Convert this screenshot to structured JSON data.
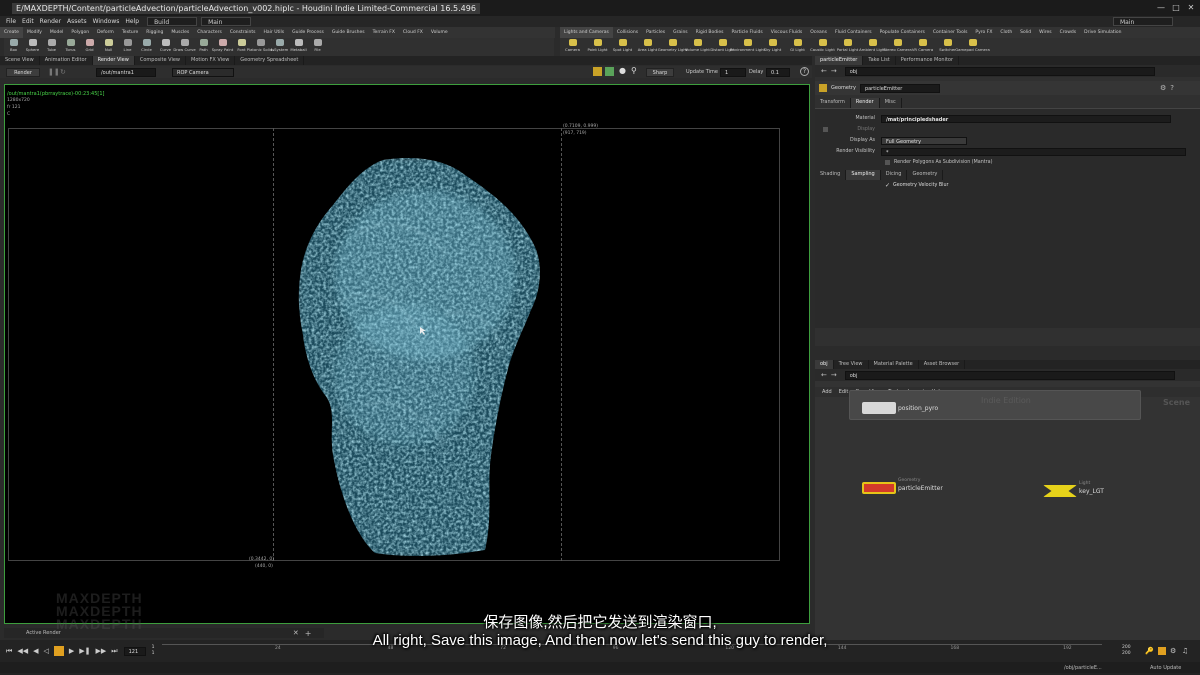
{
  "window": {
    "title": "E/MAXDEPTH/Content/particleAdvection/particleAdvection_v002.hiplc - Houdini Indie Limited-Commercial 16.5.496",
    "controls": [
      "minimize-icon",
      "maximize-icon",
      "close-icon"
    ]
  },
  "menubar": {
    "items": [
      "File",
      "Edit",
      "Render",
      "Assets",
      "Windows",
      "Help"
    ],
    "desktop1": "Build",
    "desktop2": "Main",
    "desktop_right": "Main"
  },
  "shelf_left": {
    "tabs": [
      "Create",
      "Modify",
      "Model",
      "Polygon",
      "Deform",
      "Texture",
      "Rigging",
      "Muscles",
      "Characters",
      "Constraints",
      "Hair Utils",
      "Guide Process",
      "Guide Brushes",
      "Terrain FX",
      "Cloud FX",
      "Volume"
    ],
    "tools": [
      "Box",
      "Sphere",
      "Tube",
      "Torus",
      "Grid",
      "Null",
      "Line",
      "Circle",
      "Curve",
      "Draw Curve",
      "Path",
      "Spray Paint",
      "Font",
      "Platonic Solids",
      "L-System",
      "Metaball",
      "File"
    ]
  },
  "shelf_right": {
    "tabs": [
      "Lights and Cameras",
      "Collisions",
      "Particles",
      "Grains",
      "Rigid Bodies",
      "Particle Fluids",
      "Viscous Fluids",
      "Oceans",
      "Fluid Containers",
      "Populate Containers",
      "Container Tools",
      "Pyro FX",
      "Cloth",
      "Solid",
      "Wires",
      "Crowds",
      "Drive Simulation"
    ],
    "tools": [
      "Camera",
      "Point Light",
      "Spot Light",
      "Area Light",
      "Geometry Light",
      "Volume Light",
      "Distant Light",
      "Environment Light",
      "Sky Light",
      "GI Light",
      "Caustic Light",
      "Portal Light",
      "Ambient Light",
      "Stereo Camera",
      "VR Camera",
      "Switcher",
      "Gamepad Camera"
    ]
  },
  "viewer": {
    "tabs": [
      "Scene View",
      "Animation Editor",
      "Render View",
      "Composite View",
      "Motion FX View",
      "Geometry Spreadsheet"
    ],
    "active_tab": "Render View",
    "render_button": "Render",
    "rop_path": "/out/mantra1",
    "camera": "ROP Camera",
    "sharp": "Sharp",
    "update_time_label": "Update Time",
    "update_time": "1",
    "delay_label": "Delay",
    "delay": "0.1",
    "info_line1": "/out/mantra1(pbrraytrace)-00:23:45[1]",
    "info_line2": "1280x720",
    "info_line3": "fr 121",
    "info_line4": "C",
    "coord_tr1": "(0.7109, 0.999)",
    "coord_tr2": "(917, 719)",
    "coord_bl1": "(0.3442, 0)",
    "coord_bl2": "(440, 0)",
    "bottom_tab": "Active Render"
  },
  "param_panel": {
    "tabs": [
      "particleEmitter",
      "Take List",
      "Performance Monitor"
    ],
    "path": "obj",
    "node_type": "Geometry",
    "node_name": "particleEmitter",
    "subtabs": [
      "Transform",
      "Render",
      "Misc"
    ],
    "active_subtab": "Render",
    "material_label": "Material",
    "material_value": "/mat/principledshader",
    "display_label": "Display",
    "display_as_label": "Display As",
    "display_as_value": "Full Geometry",
    "render_vis_label": "Render Visibility",
    "render_vis_value": "*",
    "render_polys": "Render Polygons As Subdivision (Mantra)",
    "sample_tabs": [
      "Shading",
      "Sampling",
      "Dicing",
      "Geometry"
    ],
    "active_sample_tab": "Sampling",
    "geo_velocity_blur": "Geometry Velocity Blur"
  },
  "network": {
    "tabs": [
      "obj",
      "Tree View",
      "Material Palette",
      "Asset Browser"
    ],
    "path": "obj",
    "menu": [
      "Add",
      "Edit",
      "Go",
      "View",
      "Tools",
      "Layout",
      "Help"
    ],
    "watermark_text": "Indie Edition",
    "scene_label": "Scene",
    "nodes": [
      {
        "type": "",
        "name": "position_pyro"
      },
      {
        "type": "Geometry",
        "name": "particleEmitter"
      },
      {
        "type": "Light",
        "name": "key_LGT"
      }
    ]
  },
  "timeline": {
    "current_frame": "121",
    "start1": "1",
    "start2": "1",
    "ticks": [
      "24",
      "48",
      "72",
      "96",
      "120",
      "144",
      "168",
      "192"
    ],
    "end1": "200",
    "end2": "200",
    "status_path": "/obj/particleE...",
    "auto_update": "Auto Update"
  },
  "subtitles": {
    "chinese": "保存图像,然后把它发送到渲染窗口,",
    "english": "All right, Save this image, And then now let's send this guy to render,"
  },
  "brand_watermark": [
    "MAXDEPTH",
    "MAXDEPTH",
    "MAXDEPTH"
  ],
  "colors": {
    "viewport_border": "#3d9e3d",
    "smoke": "#6fc3d9",
    "info_text": "#49d649"
  }
}
